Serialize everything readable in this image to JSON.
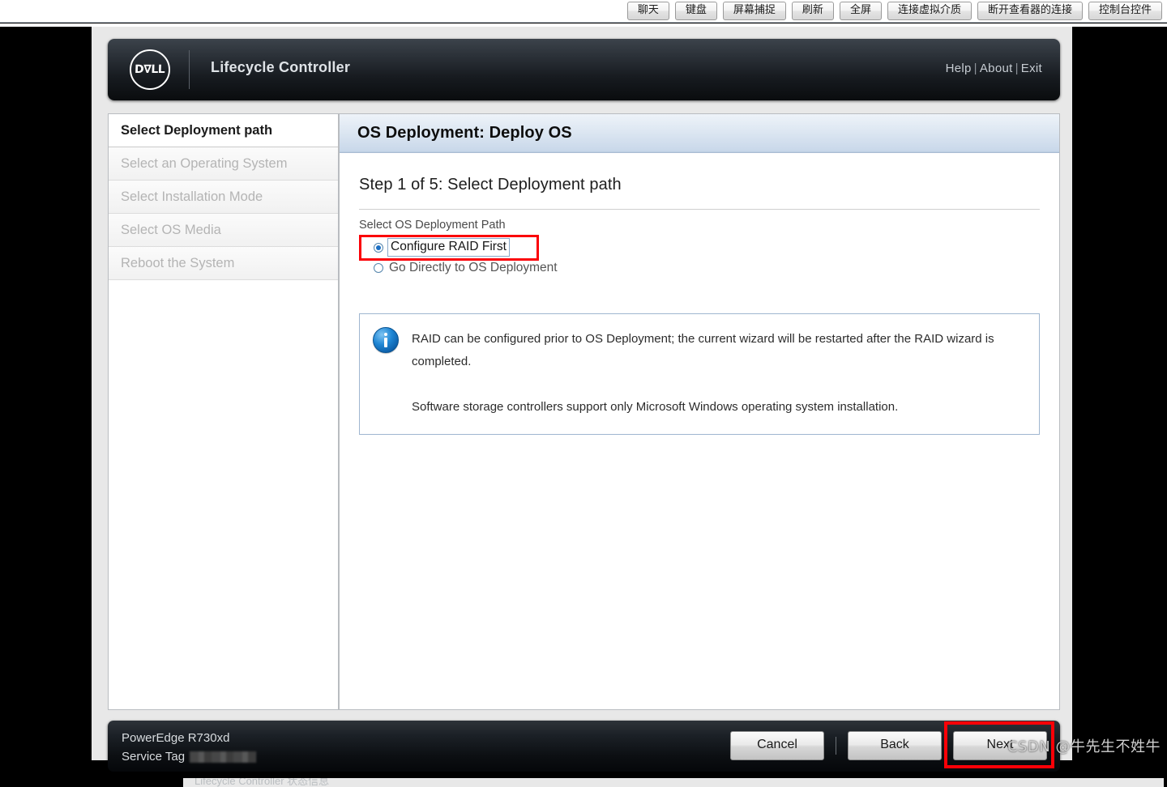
{
  "viewer_toolbar": {
    "buttons": [
      {
        "label": "聊天",
        "name": "chat"
      },
      {
        "label": "键盘",
        "name": "keyboard"
      },
      {
        "label": "屏幕捕捉",
        "name": "screen-capture"
      },
      {
        "label": "刷新",
        "name": "refresh"
      },
      {
        "label": "全屏",
        "name": "fullscreen"
      },
      {
        "label": "连接虚拟介质",
        "name": "connect-virtual-media"
      },
      {
        "label": "断开查看器的连接",
        "name": "disconnect-viewer"
      },
      {
        "label": "控制台控件",
        "name": "console-controls"
      }
    ]
  },
  "header": {
    "logo_text": "D∇LL",
    "title": "Lifecycle Controller",
    "links": [
      {
        "label": "Help"
      },
      {
        "label": "About"
      },
      {
        "label": "Exit"
      }
    ],
    "link_separator": "|"
  },
  "sidebar": {
    "items": [
      {
        "label": "Select Deployment path",
        "active": true
      },
      {
        "label": "Select an Operating System",
        "active": false
      },
      {
        "label": "Select Installation Mode",
        "active": false
      },
      {
        "label": "Select OS Media",
        "active": false
      },
      {
        "label": "Reboot the System",
        "active": false
      }
    ]
  },
  "content": {
    "title": "OS Deployment: Deploy OS",
    "step_title": "Step 1 of 5: Select Deployment path",
    "section_label": "Select OS Deployment Path",
    "radio_options": [
      {
        "label": "Configure RAID First",
        "selected": true,
        "focused": true
      },
      {
        "label": "Go Directly to OS Deployment",
        "selected": false,
        "focused": false
      }
    ],
    "info": {
      "icon": "info-icon",
      "paragraph_1": "RAID can be configured prior to OS Deployment; the current wizard will be restarted after the RAID wizard is completed.",
      "paragraph_2": "Software storage controllers support only Microsoft Windows operating system installation."
    }
  },
  "footer": {
    "model": "PowerEdge R730xd",
    "service_tag_label": "Service Tag",
    "service_tag_value": "",
    "buttons": [
      {
        "label": "Cancel",
        "name": "cancel"
      },
      {
        "label": "Back",
        "name": "back"
      },
      {
        "label": "Next",
        "name": "next"
      }
    ]
  },
  "annotations": {
    "highlight_color": "#fb0007",
    "watermark": "CSDN @牛先生不姓牛",
    "bottom_cutoff_text": "Lifecycle Controller 状态信息"
  }
}
